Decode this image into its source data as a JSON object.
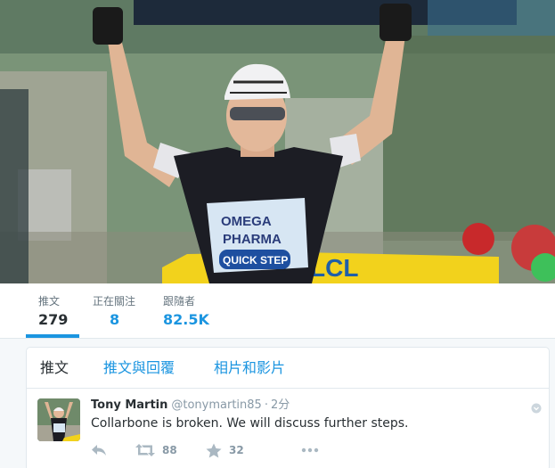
{
  "profile": {
    "stats": [
      {
        "label": "推文",
        "value": "279"
      },
      {
        "label": "正在關注",
        "value": "8"
      },
      {
        "label": "跟隨者",
        "value": "82.5K"
      }
    ]
  },
  "timeline": {
    "tabs": [
      "推文",
      "推文與回覆",
      "相片和影片"
    ]
  },
  "tweet": {
    "fullname": "Tony Martin",
    "username": "@tonymartin85",
    "separator": "·",
    "time": "2分",
    "text": "Collarbone is broken. We will discuss further steps.",
    "retweets": "88",
    "likes": "32"
  },
  "banner": {
    "jersey_lines": [
      "OMEGA",
      "PHARMA",
      "QUICK STEP"
    ],
    "banner_text": "LCL"
  },
  "colors": {
    "accent": "#1b95e0",
    "text": "#292f33",
    "muted": "#8899a6",
    "border": "#e1e8ed"
  }
}
